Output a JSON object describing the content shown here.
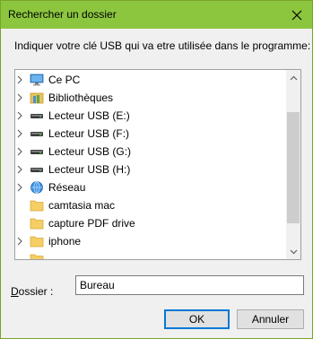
{
  "window": {
    "title": "Rechercher un dossier",
    "close_icon": "close-icon",
    "accent": "#8cc63f"
  },
  "instruction": "Indiquer votre clé USB qui va etre utilisée dans le programme:",
  "tree": {
    "items": [
      {
        "label": "Ce PC",
        "icon": "computer-icon",
        "expandable": true
      },
      {
        "label": "Bibliothèques",
        "icon": "library-icon",
        "expandable": true
      },
      {
        "label": "Lecteur USB (E:)",
        "icon": "usb-drive-icon",
        "expandable": true
      },
      {
        "label": "Lecteur USB (F:)",
        "icon": "usb-drive-icon",
        "expandable": true
      },
      {
        "label": "Lecteur USB (G:)",
        "icon": "usb-drive-icon",
        "expandable": true
      },
      {
        "label": "Lecteur USB (H:)",
        "icon": "usb-drive-icon",
        "expandable": true
      },
      {
        "label": "Réseau",
        "icon": "network-icon",
        "expandable": true
      },
      {
        "label": "camtasia mac",
        "icon": "folder-icon",
        "expandable": false
      },
      {
        "label": "capture PDF drive",
        "icon": "folder-icon",
        "expandable": false
      },
      {
        "label": "iphone",
        "icon": "folder-icon",
        "expandable": true
      }
    ]
  },
  "folder": {
    "label": "Dossier :",
    "mnemonic": "D",
    "label_rest": "ossier :",
    "value": "Bureau"
  },
  "buttons": {
    "ok": "OK",
    "cancel": "Annuler"
  }
}
